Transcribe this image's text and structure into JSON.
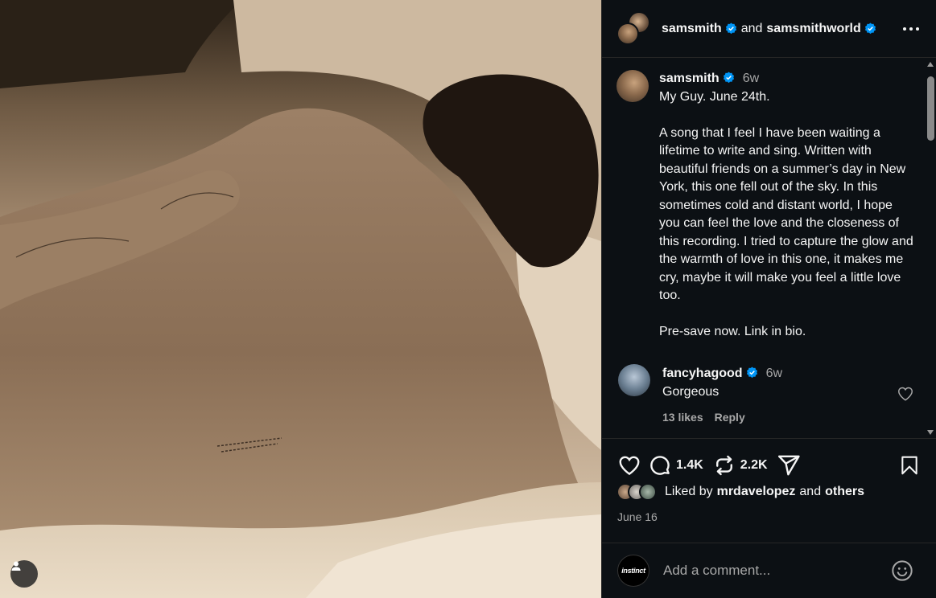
{
  "header": {
    "author": "samsmith",
    "conjunction": "and",
    "collaborator": "samsmithworld"
  },
  "caption": {
    "author": "samsmith",
    "time": "6w",
    "text": "My Guy. June 24th.\n\nA song that I feel I have been waiting a lifetime to write and sing. Written with beautiful friends on a summer’s day in New York, this one fell out of the sky. In this sometimes cold and distant world, I hope you can feel the love and the closeness of this recording. I tried to capture the glow and the warmth of love in this one, it makes me cry, maybe it will make you feel a little love too.\n\nPre-save now. Link in bio."
  },
  "comment": {
    "author": "fancyhagood",
    "time": "6w",
    "text": "Gorgeous",
    "likes": "13 likes",
    "reply": "Reply"
  },
  "actions": {
    "comments_count": "1.4K",
    "reposts_count": "2.2K"
  },
  "likes": {
    "prefix": "Liked by",
    "user": "mrdavelopez",
    "conjunction": "and",
    "others": "others"
  },
  "post_date": "June 16",
  "add_comment": {
    "avatar_label": "instinct",
    "placeholder": "Add a comment..."
  },
  "colors": {
    "background": "#0c1014",
    "verified": "#0095f6",
    "secondary_text": "#a8a8a8"
  }
}
